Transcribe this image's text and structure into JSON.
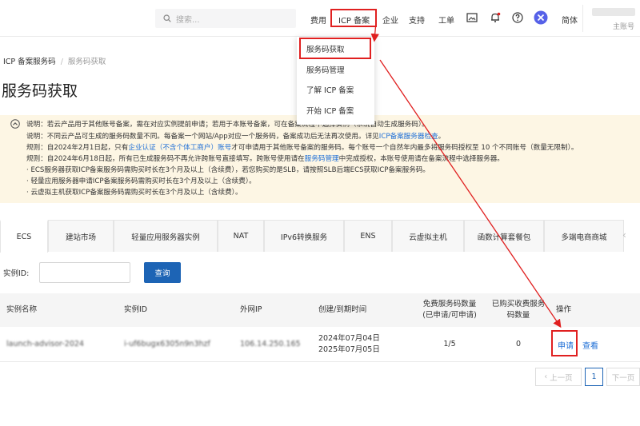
{
  "header": {
    "search_placeholder": "搜索...",
    "nav": [
      "费用",
      "ICP 备案",
      "企业",
      "支持",
      "工单"
    ],
    "lang": "简体",
    "user_sub": "主账号"
  },
  "dropdown": {
    "items": [
      "服务码获取",
      "服务码管理",
      "了解 ICP 备案",
      "开始 ICP 备案"
    ]
  },
  "breadcrumb": {
    "root": "ICP 备案服务码",
    "sep": "/",
    "current": "服务码获取"
  },
  "page_title": "服务码获取",
  "notice": {
    "l1": "说明：若云产品用于其他账号备案，需在对应实例提前申请；若用于本账号备案，可在备案流程中选择实例（系统自动生成服务码）。",
    "l2a": "说明：不同云产品可生成的服务码数量不同。每备案一个网站/App对应一个服务码，备案成功后无法再次使用。详见",
    "l2b": "ICP备案服务器检查",
    "l2c": "。",
    "l3a": "规则：自2024年2月1日起，只有",
    "l3b": "企业认证（不含个体工商户）账号",
    "l3c": "才可申请用于其他账号备案的服务码。每个账号一个自然年内最多将服务码授权至 10 个不同账号（数量无限制）。",
    "l4a": "规则：自2024年6月18日起，所有已生成服务码不再允许跨账号直接填写。跨账号使用请在",
    "l4b": "服务码管理",
    "l4c": "中完成授权，本账号使用请在备案流程中选择服务器。",
    "l5": "· ECS服务器获取ICP备案服务码需购买时长在3个月及以上（含续费），若您购买的是SLB，请按照SLB后端ECS获取ICP备案服务码。",
    "l6": "· 轻量应用服务器申请ICP备案服务码需购买时长在3个月及以上（含续费）。",
    "l7": "· 云虚拟主机获取ICP备案服务码需购买时长在3个月及以上（含续费）。"
  },
  "tabs": [
    "ECS",
    "建站市场",
    "轻量应用服务器实例",
    "NAT",
    "IPv6转换服务",
    "ENS",
    "云虚拟主机",
    "函数计算套餐包",
    "多端电商商城"
  ],
  "filter": {
    "label": "实例ID:",
    "button": "查询"
  },
  "table": {
    "headers": {
      "name": "实例名称",
      "id": "实例ID",
      "ip": "外网IP",
      "time": "创建/到期时间",
      "free1": "免费服务码数量",
      "free2": "(已申请/可申请)",
      "paid1": "已购买收费服务",
      "paid2": "码数量",
      "op": "操作"
    },
    "row": {
      "name": "launch-advisor-2024",
      "id": "i-uf6bugx6305n9n3hzf",
      "ip": "106.14.250.165",
      "create": "2024年07月04日",
      "expire": "2025年07月05日",
      "free": "1/5",
      "paid": "0",
      "apply": "申请",
      "view": "查看"
    }
  },
  "pagination": {
    "prev": "上一页",
    "page": "1",
    "next": "下一页"
  },
  "colors": {
    "accent": "#1d64b5",
    "highlight": "#e02020",
    "notice_bg": "#fdf6e4"
  }
}
